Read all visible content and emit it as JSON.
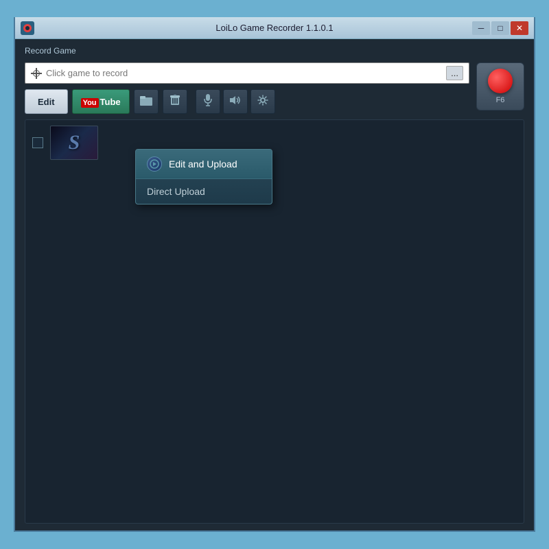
{
  "titleBar": {
    "title": "LoiLo Game Recorder 1.1.0.1",
    "minimize": "─",
    "maximize": "□",
    "close": "✕"
  },
  "recordSection": {
    "label": "Record Game",
    "gamePlaceholder": "Click game to record",
    "dotsLabel": "...",
    "recordKey": "F6"
  },
  "toolbar": {
    "editLabel": "Edit",
    "youtubeLabel": "YouTube",
    "folderIcon": "📁",
    "trashIcon": "🗑",
    "micIcon": "🎤",
    "speakerIcon": "🔊",
    "gearIcon": "⚙"
  },
  "dropdown": {
    "editAndUpload": "Edit and Upload",
    "directUpload": "Direct Upload"
  },
  "videoItem": {
    "letter": "S"
  }
}
